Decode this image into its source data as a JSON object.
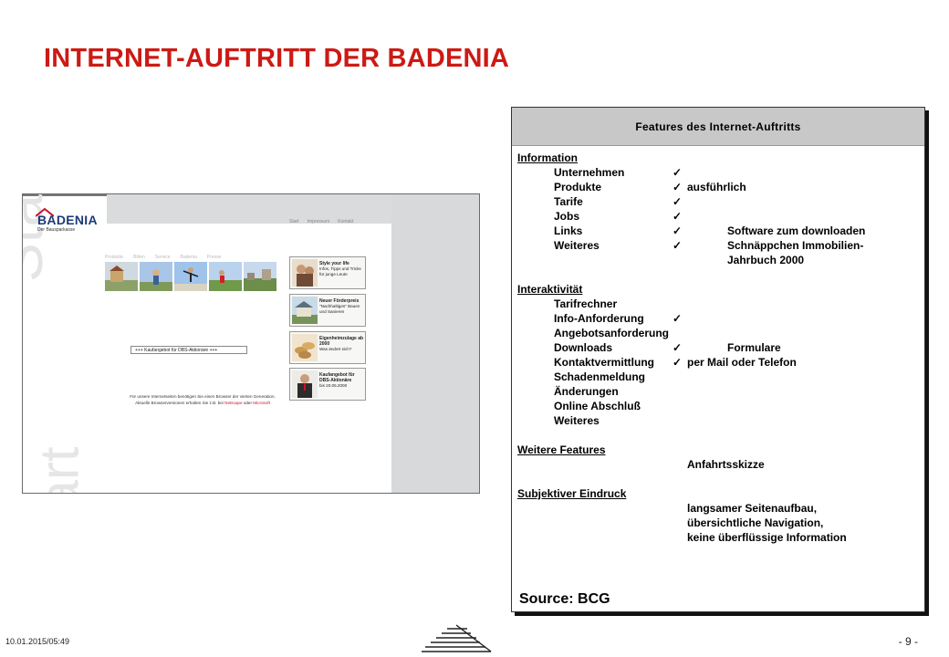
{
  "page": {
    "title": "INTERNET-AUFTRITT DER BADENIA",
    "date": "10.01.2015/05:49",
    "page_number": "- 9 -"
  },
  "screenshot": {
    "logo_name": "BADENIA",
    "logo_sub": "Der Bausparkasse",
    "topnav": [
      "Start",
      "Impressum",
      "Kontakt"
    ],
    "sidenav": [
      "Produkte",
      "Bitten",
      "Service",
      "Badenia",
      "Presse"
    ],
    "start_text": "Start",
    "start_text2": "art",
    "kauf_box": "+++ Kaufangebot für DBS-Aktionäre +++",
    "browser_note_1": "Für unsere Internetseiten benötigen Sie einen Browser der vierten Generation.",
    "browser_note_2a": "Aktuelle Browserversionen erhalten Sie z.B. bei ",
    "browser_note_netscape": "Netscape",
    "browser_note_2b": " oder ",
    "browser_note_microsoft": "Microsoft",
    "cards": [
      {
        "title": "Style your life",
        "text": "Infos, Tipps und Tricks für junge Leute"
      },
      {
        "title": "Neuer Förderpreis",
        "text": "\"Nachhaltiges\" Bauen und Sanieren"
      },
      {
        "title": "Eigenheimzulage ab 2000",
        "text": "Was ändert sich?"
      },
      {
        "title": "Kaufangebot für DBS-Aktionäre",
        "text": "bis 20.05.2000"
      }
    ]
  },
  "features": {
    "header": "Features des Internet-Auftritts",
    "check_symbol": "✓",
    "information": {
      "label": "Information",
      "items": [
        {
          "name": "Unternehmen",
          "check": true,
          "note": ""
        },
        {
          "name": "Produkte",
          "check": true,
          "note": "ausführlich"
        },
        {
          "name": "Tarife",
          "check": true,
          "note": ""
        },
        {
          "name": "Jobs",
          "check": true,
          "note": ""
        },
        {
          "name": "Links",
          "check": true,
          "note": "Software zum downloaden"
        },
        {
          "name": "Weiteres",
          "check": true,
          "note": "Schnäppchen Immobilien-",
          "note2": "Jahrbuch 2000"
        }
      ]
    },
    "interaktivitaet": {
      "label": "Interaktivität",
      "items": [
        {
          "name": "Tarifrechner",
          "check": false,
          "note": ""
        },
        {
          "name": "Info-Anforderung",
          "check": true,
          "note": ""
        },
        {
          "name": "Angebotsanforderung",
          "check": false,
          "note": ""
        },
        {
          "name": "Downloads",
          "check": true,
          "note": "Formulare"
        },
        {
          "name": "Kontaktvermittlung",
          "check": true,
          "note": "per Mail oder Telefon"
        },
        {
          "name": "Schadenmeldung",
          "check": false,
          "note": ""
        },
        {
          "name": "Änderungen",
          "check": false,
          "note": ""
        },
        {
          "name": "Online Abschluß",
          "check": false,
          "note": ""
        },
        {
          "name": "Weiteres",
          "check": false,
          "note": ""
        }
      ]
    },
    "weitere": {
      "label": "Weitere Features",
      "note": "Anfahrtsskizze"
    },
    "eindruck": {
      "label": "Subjektiver Eindruck",
      "lines": [
        "langsamer Seitenaufbau,",
        "übersichtliche Navigation,",
        "keine überflüssige Information"
      ]
    },
    "source": "Source: BCG"
  },
  "colors": {
    "title_red": "#cc1a14",
    "header_grey": "#c8c8c8",
    "logo_blue": "#1c3a78"
  }
}
